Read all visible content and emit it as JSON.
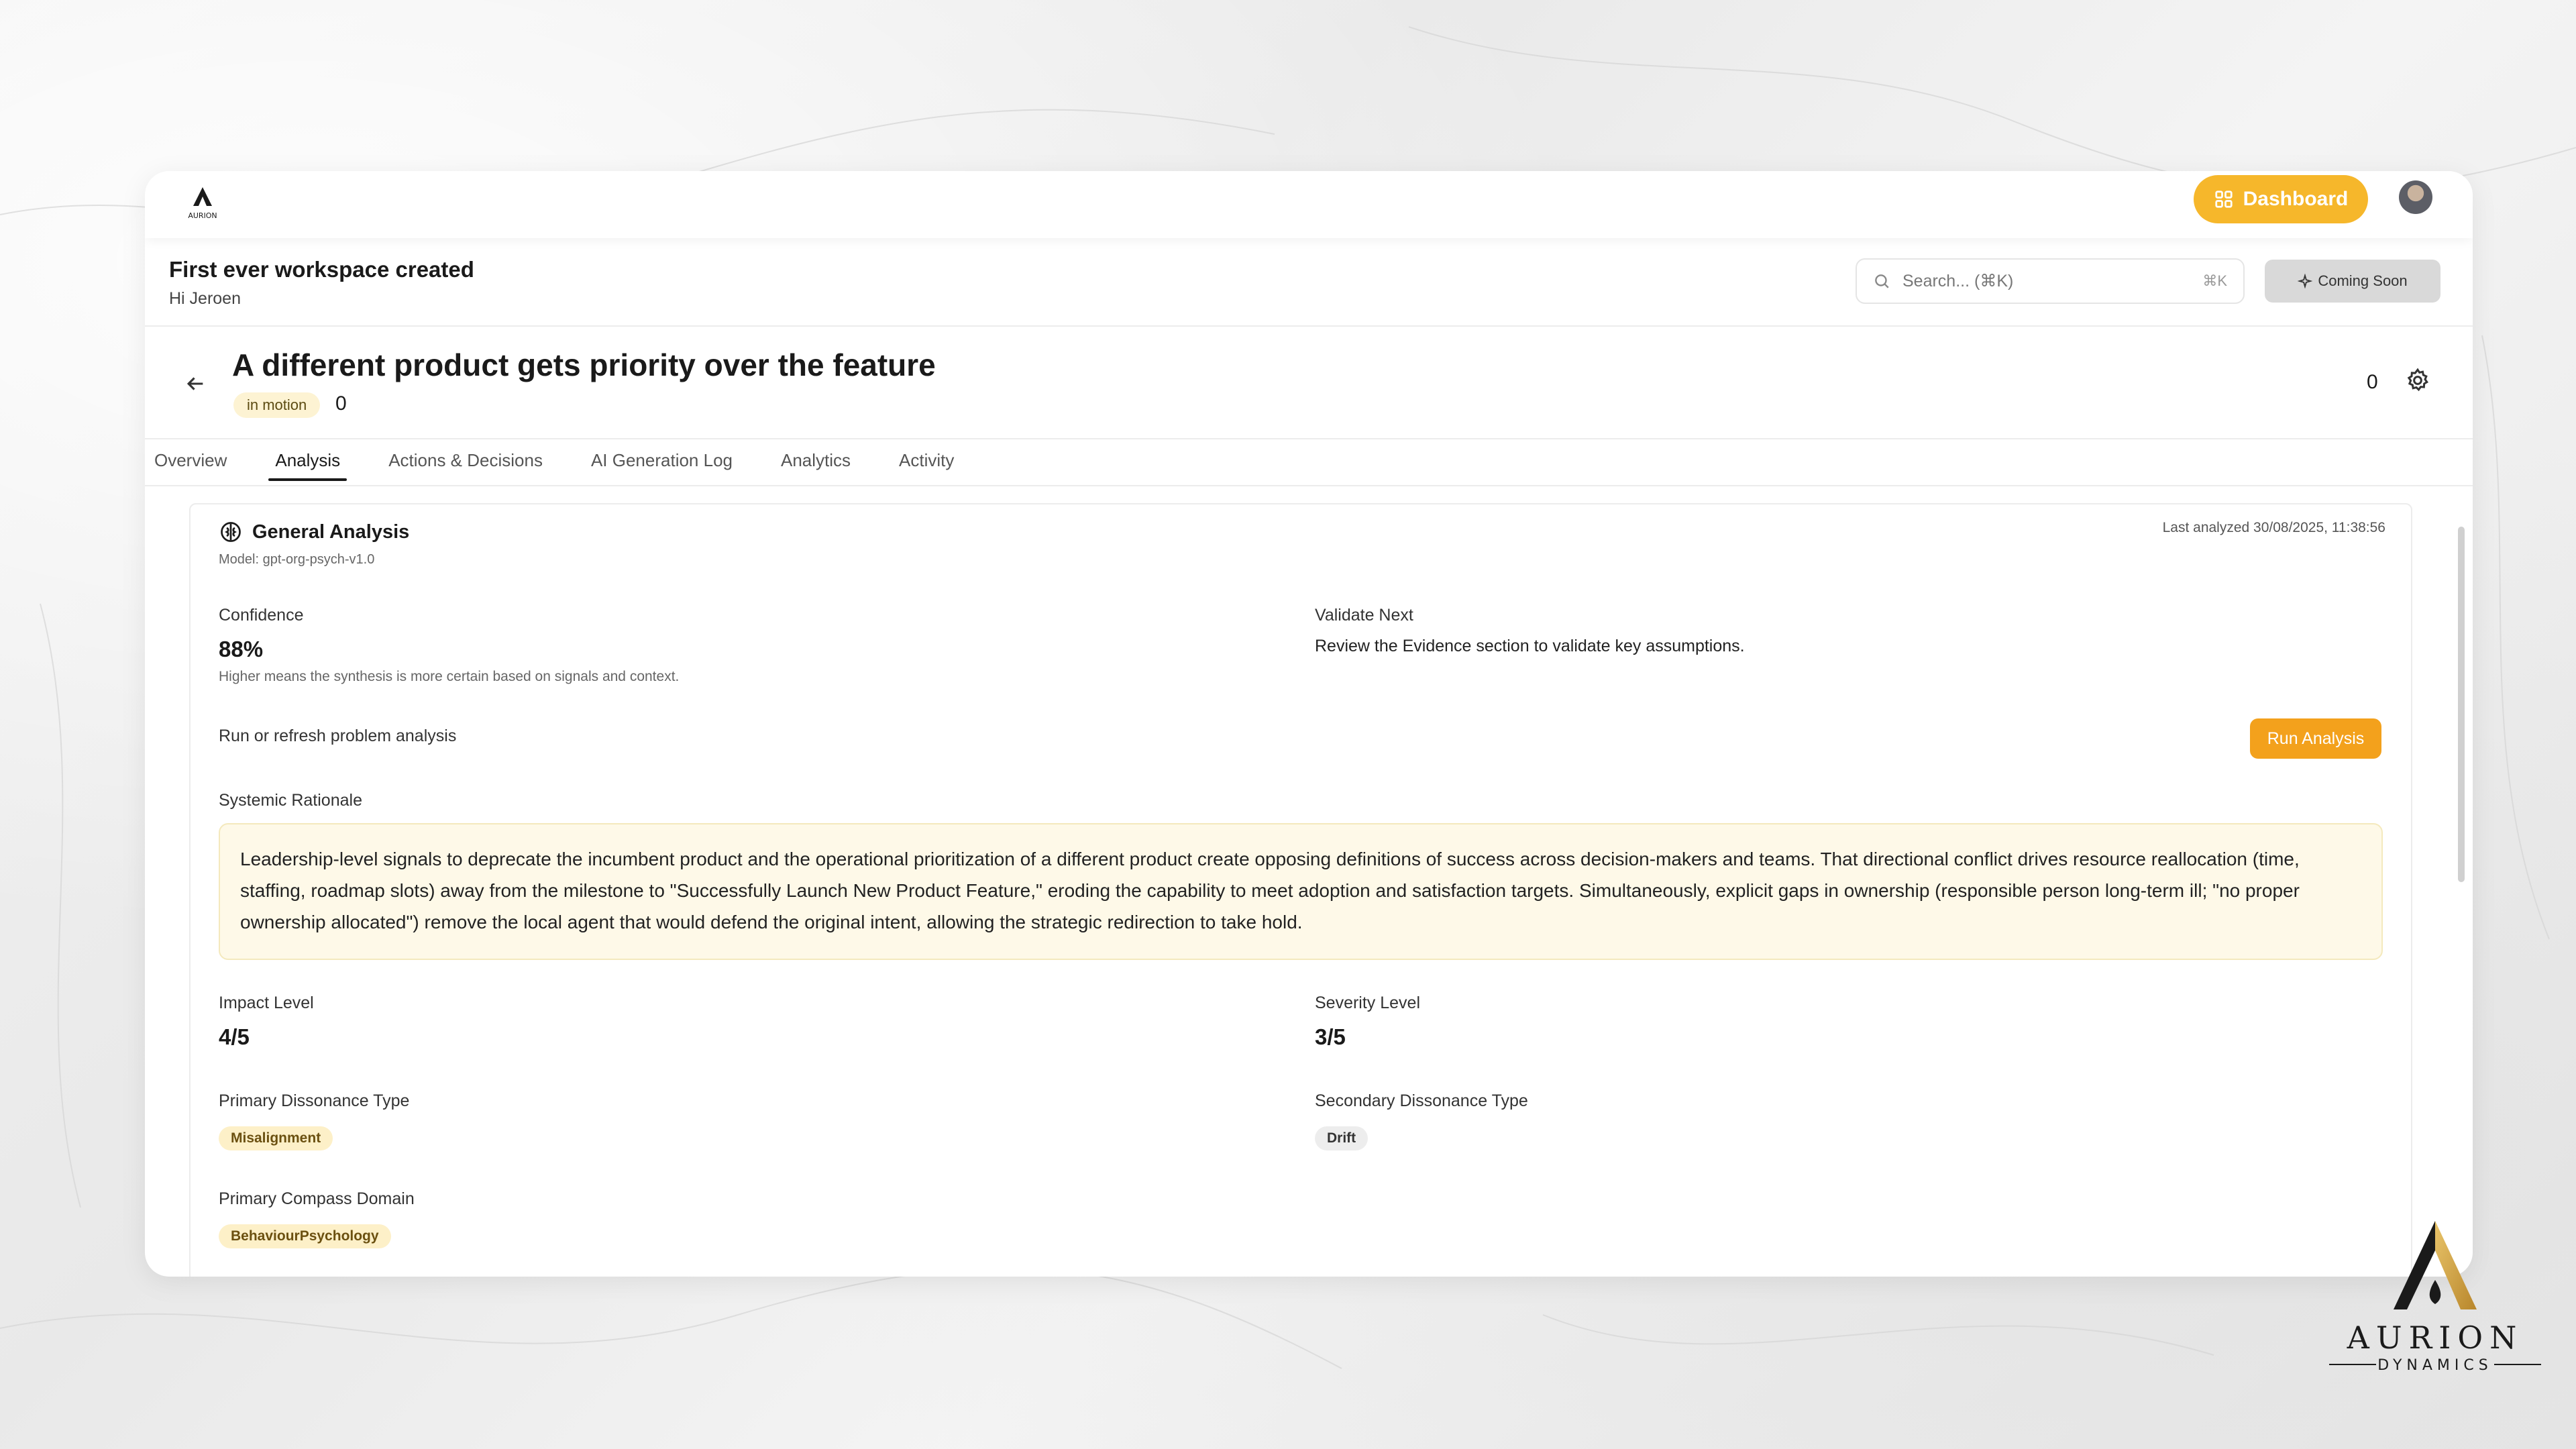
{
  "topbar": {
    "dashboard_label": "Dashboard"
  },
  "workspace": {
    "title": "First ever workspace created",
    "greeting": "Hi Jeroen"
  },
  "search": {
    "placeholder": "Search... (⌘K)",
    "shortcut": "⌘K"
  },
  "coming_soon": {
    "label": "Coming Soon"
  },
  "problem": {
    "title": "A different product gets priority over the feature",
    "status": "in motion",
    "status_count": "0",
    "right_count": "0"
  },
  "tabs": [
    {
      "label": "Overview"
    },
    {
      "label": "Analysis"
    },
    {
      "label": "Actions & Decisions"
    },
    {
      "label": "AI Generation Log"
    },
    {
      "label": "Analytics"
    },
    {
      "label": "Activity"
    }
  ],
  "active_tab": "Analysis",
  "analysis": {
    "title": "General Analysis",
    "model": "Model: gpt-org-psych-v1.0",
    "last_analyzed": "Last analyzed 30/08/2025, 11:38:56",
    "confidence_label": "Confidence",
    "confidence_value": "88%",
    "confidence_hint": "Higher means the synthesis is more certain based on signals and context.",
    "validate_label": "Validate Next",
    "validate_text": "Review the Evidence section to validate key assumptions.",
    "run_prompt": "Run or refresh problem analysis",
    "run_button": "Run Analysis",
    "rationale_label": "Systemic Rationale",
    "rationale_text": "Leadership-level signals to deprecate the incumbent product and the operational prioritization of a different product create opposing definitions of success across decision-makers and teams. That directional conflict drives resource reallocation (time, staffing, roadmap slots) away from the milestone to \"Successfully Launch New Product Feature,\" eroding the capability to meet adoption and satisfaction targets. Simultaneously, explicit gaps in ownership (responsible person long-term ill; \"no proper ownership allocated\") remove the local agent that would defend the original intent, allowing the strategic redirection to take hold.",
    "impact_label": "Impact Level",
    "impact_value": "4/5",
    "severity_label": "Severity Level",
    "severity_value": "3/5",
    "primary_dissonance_label": "Primary Dissonance Type",
    "primary_dissonance_value": "Misalignment",
    "secondary_dissonance_label": "Secondary Dissonance Type",
    "secondary_dissonance_value": "Drift",
    "compass_label": "Primary Compass Domain",
    "compass_value": "BehaviourPsychology"
  },
  "brand": {
    "name": "AURION",
    "tagline": "DYNAMICS"
  },
  "colors": {
    "accent": "#f6b72b",
    "run_button": "#f3a11c",
    "rationale_bg": "#fef9e8"
  }
}
